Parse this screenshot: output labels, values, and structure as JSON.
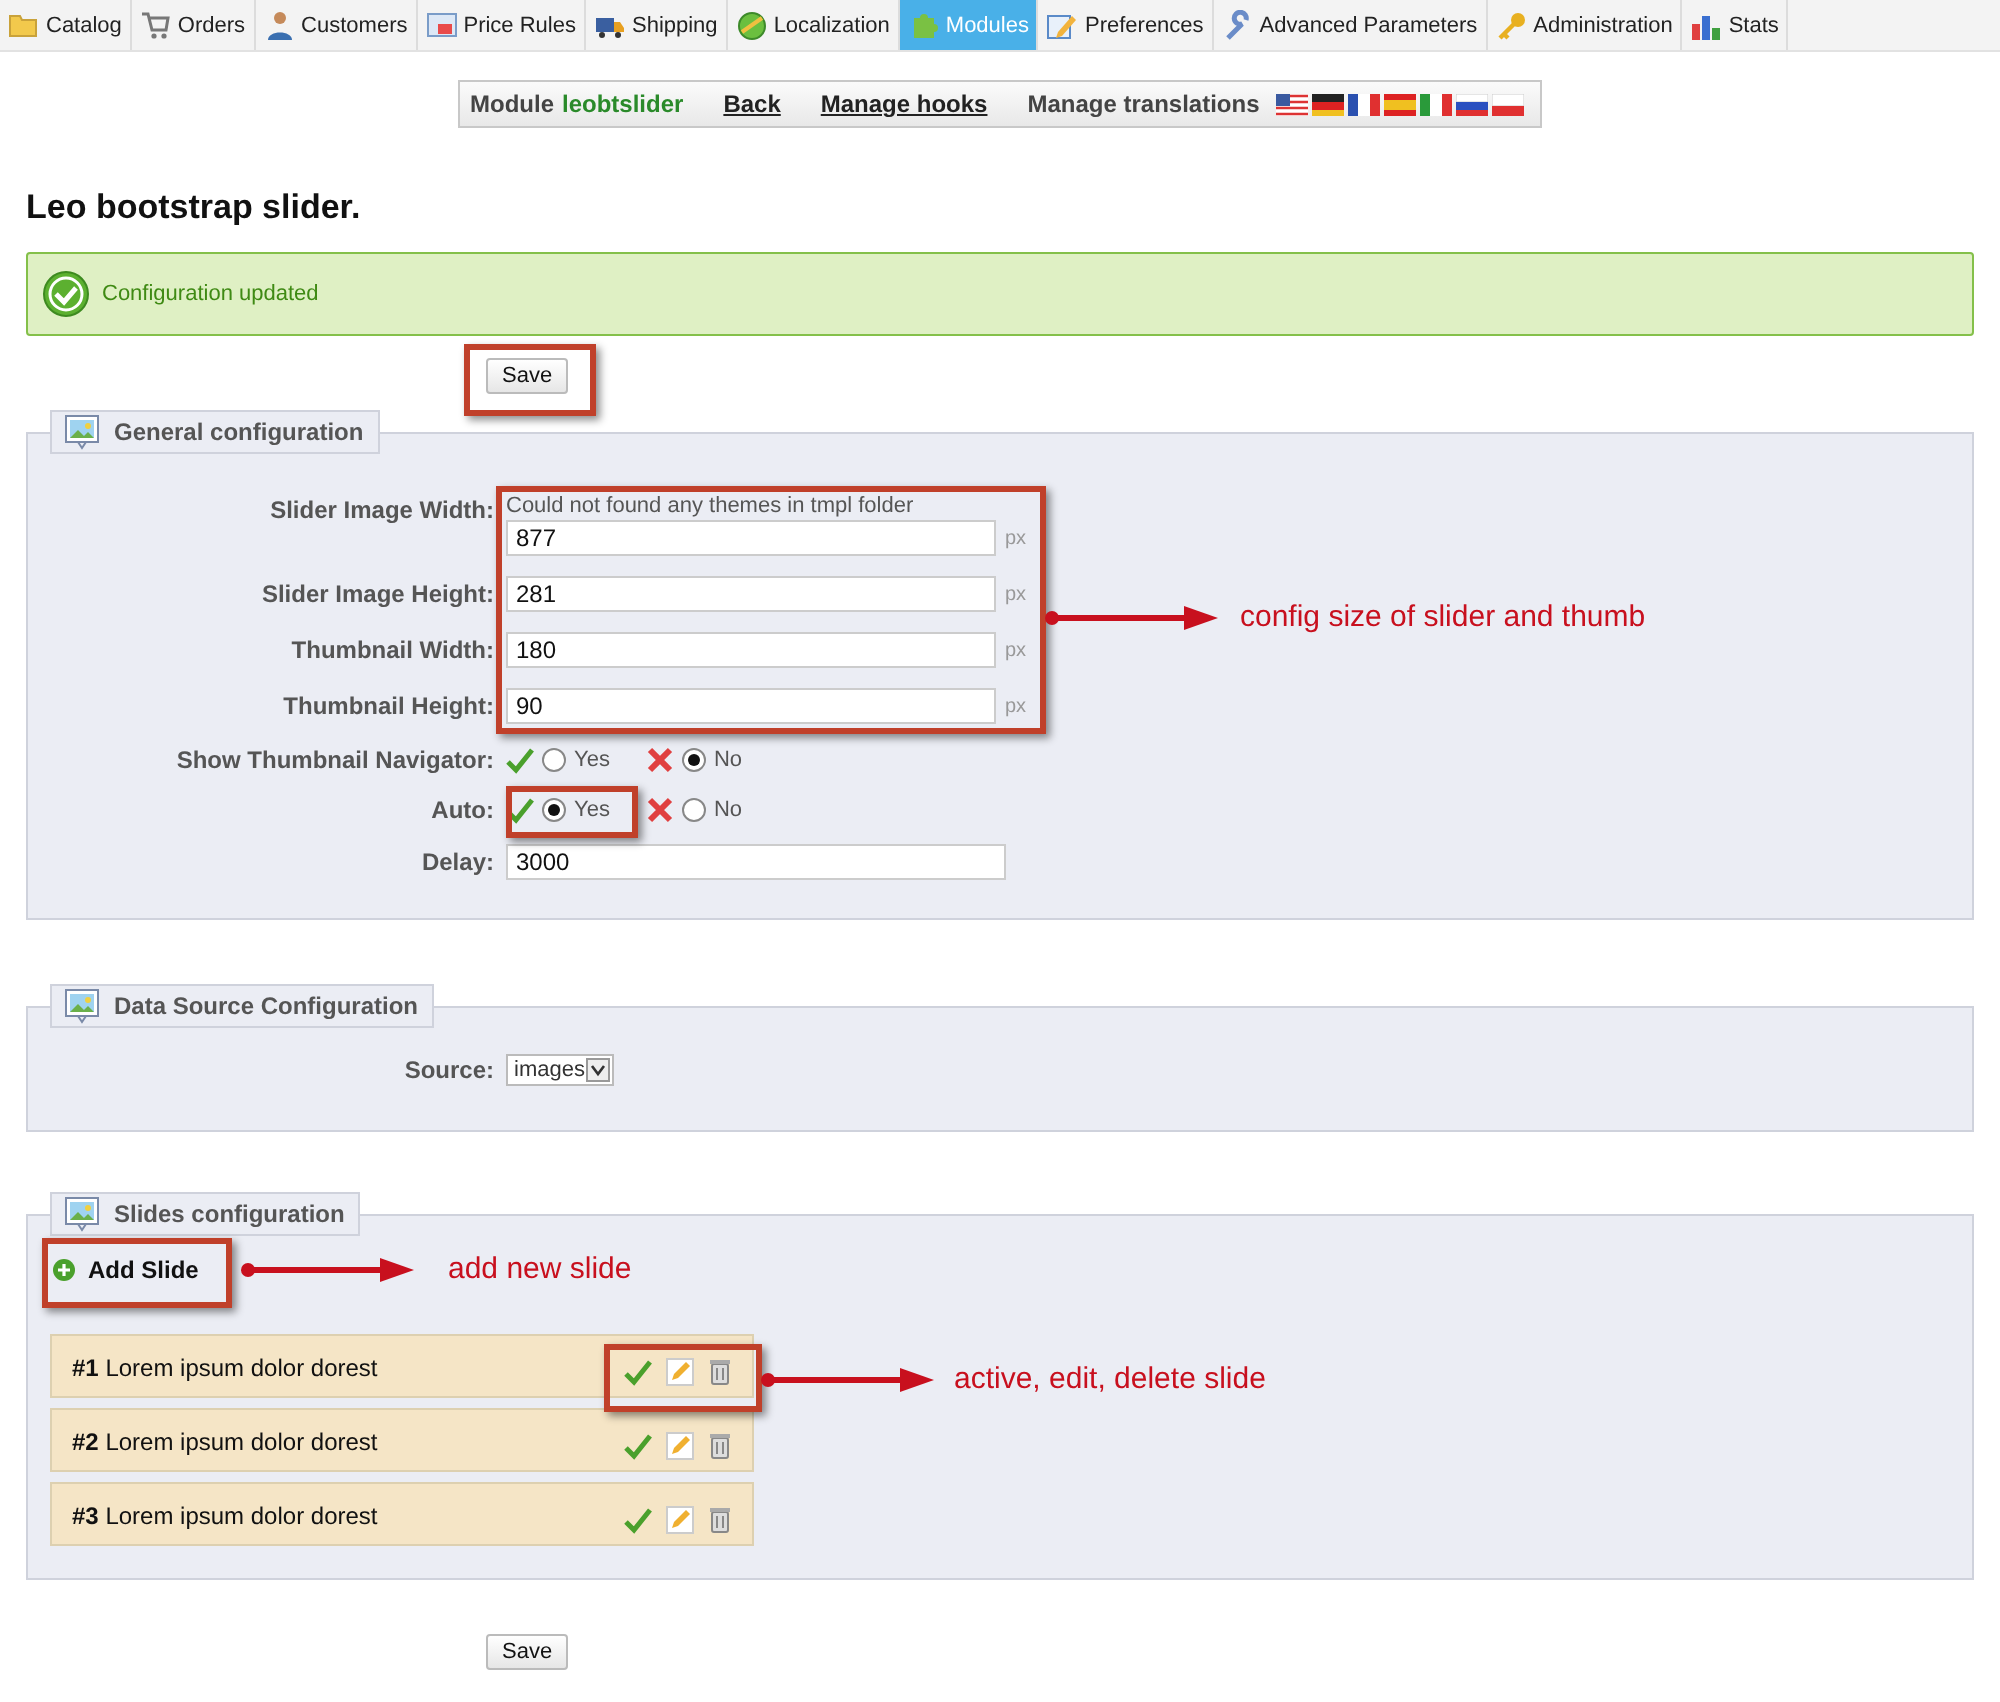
{
  "tabs": [
    {
      "label": "Catalog",
      "selected": false
    },
    {
      "label": "Orders",
      "selected": false
    },
    {
      "label": "Customers",
      "selected": false
    },
    {
      "label": "Price Rules",
      "selected": false
    },
    {
      "label": "Shipping",
      "selected": false
    },
    {
      "label": "Localization",
      "selected": false
    },
    {
      "label": "Modules",
      "selected": true
    },
    {
      "label": "Preferences",
      "selected": false
    },
    {
      "label": "Advanced Parameters",
      "selected": false
    },
    {
      "label": "Administration",
      "selected": false
    },
    {
      "label": "Stats",
      "selected": false
    }
  ],
  "toolbar": {
    "module_label": "Module",
    "module_name": "leobtslider",
    "links": [
      "Back",
      "Manage hooks"
    ],
    "translations_label": "Manage translations"
  },
  "title": "Leo bootstrap slider.",
  "alert": {
    "message": "Configuration updated"
  },
  "save_button": "Save",
  "sections": [
    {
      "legend": "General configuration",
      "fields": [
        {
          "kind": "text",
          "label": "Slider Image Width:",
          "note": "Could not found any themes in tmpl folder",
          "value": "877",
          "unit": "px"
        },
        {
          "kind": "text",
          "label": "Slider Image Height:",
          "value": "281",
          "unit": "px"
        },
        {
          "kind": "text",
          "label": "Thumbnail Width:",
          "value": "180",
          "unit": "px"
        },
        {
          "kind": "text",
          "label": "Thumbnail Height:",
          "value": "90",
          "unit": "px"
        },
        {
          "kind": "radio",
          "label": "Show Thumbnail Navigator:",
          "options": [
            {
              "label": "Yes",
              "selected": false
            },
            {
              "label": "No",
              "selected": true
            }
          ]
        },
        {
          "kind": "radio",
          "label": "Auto:",
          "options": [
            {
              "label": "Yes",
              "selected": true
            },
            {
              "label": "No",
              "selected": false
            }
          ]
        },
        {
          "kind": "text",
          "label": "Delay:",
          "value": "3000"
        }
      ]
    },
    {
      "legend": "Data Source Configuration",
      "fields": [
        {
          "kind": "select",
          "label": "Source:",
          "value": "images"
        }
      ]
    },
    {
      "legend": "Slides configuration",
      "add_button": "Add Slide",
      "slides": [
        {
          "number": "#1",
          "title": "Lorem ipsum dolor dorest",
          "active": true
        },
        {
          "number": "#2",
          "title": "Lorem ipsum dolor dorest",
          "active": true
        },
        {
          "number": "#3",
          "title": "Lorem ipsum dolor dorest",
          "active": true
        }
      ]
    }
  ],
  "bottom_save_button": "Save",
  "annotations": [
    {
      "text": "config size of slider and thumb"
    },
    {
      "text": "add new slide"
    },
    {
      "text": "active, edit, delete slide"
    }
  ]
}
